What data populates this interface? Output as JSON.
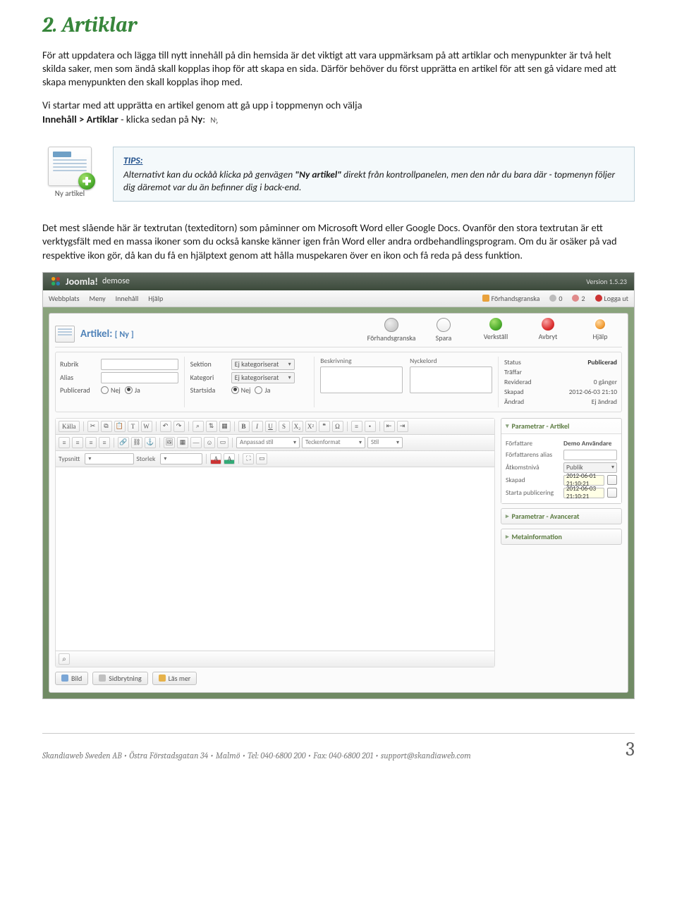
{
  "section_title": "2. Artiklar",
  "para1": "För att uppdatera och lägga till nytt innehåll på din hemsida är det viktigt att vara uppmärksam på att artiklar och menypunkter är två helt skilda saker, men som ändå skall kopplas ihop för att skapa en sida. Därför behöver du först upprätta en artikel för att sen gå vidare med att skapa menypunkten den skall kopplas ihop med.",
  "para2_a": "Vi startar med att upprätta en artikel genom att gå upp i  toppmenyn och välja",
  "para2_b_bold": "Innehåll > Artiklar",
  "para2_c": " - klicka sedan på N",
  "para2_d_bold": "y",
  "para2_e": ":",
  "ny_label": "Ny",
  "thumb_label": "Ny artikel",
  "tips_head": "TIPS:",
  "tips_body_a": "Alternativt kan du ockåå klicka på genvägen ",
  "tips_body_b": "\"Ny artikel\"",
  "tips_body_c": " direkt från kontrollpanelen, men den når du bara där  - topmenyn följer dig däremot var du än befinner dig i back-end.",
  "para3": "Det mest slående här är textrutan (texteditorn) som påminner om Microsoft Word eller Google Docs. Ovanför den stora textrutan är ett verktygsfält med en massa ikoner som du också kanske känner igen från Word eller andra ordbehandlingsprogram. Om du är osäker på vad respektive ikon gör, då kan du få en hjälptext genom att hålla muspekaren över en ikon och få reda på dess funktion.",
  "joomla": {
    "logo": "Joomla!",
    "site": "demose",
    "version": "Version 1.5.23",
    "menubar": {
      "items": [
        "Webbplats",
        "Meny",
        "Innehåll",
        "Hjälp"
      ],
      "right": {
        "preview": "Förhandsgranska",
        "msg": "0",
        "users": "2",
        "logout": "Logga ut"
      }
    },
    "title": "Artikel:",
    "title_sub": "[ Ny ]",
    "toolbar": [
      "Förhandsgranska",
      "Spara",
      "Verkställ",
      "Avbryt",
      "Hjälp"
    ],
    "form_left": {
      "rubrik": "Rubrik",
      "alias": "Alias",
      "publicerad": "Publicerad",
      "nej": "Nej",
      "ja": "Ja"
    },
    "form_left2": {
      "sektion": "Sektion",
      "kategori": "Kategori",
      "startsida": "Startsida",
      "sektion_val": "Ej kategoriserat",
      "kategori_val": "Ej kategoriserat"
    },
    "form_mid": {
      "beskrivning": "Beskrivning",
      "nyckelord": "Nyckelord"
    },
    "form_right": {
      "status_l": "Status",
      "status_v": "Publicerad",
      "traffar": "Träffar",
      "rev_l": "Reviderad",
      "rev_v": "0 gånger",
      "skapad_l": "Skapad",
      "skapad_v": "2012-06-03 21:10",
      "andrad_l": "Ändrad",
      "andrad_v": "Ej ändrad"
    },
    "editor": {
      "kalla": "Källa",
      "row2": {
        "typsnitt": "Typsnitt",
        "storlek": "Storlek",
        "anpassad": "Anpassad stil",
        "tecken": "Teckenformat",
        "stil": "Stil"
      },
      "footer_btns": [
        "Bild",
        "Sidbrytning",
        "Läs mer"
      ]
    },
    "sidebar": {
      "p_artikel": "Parametrar - Artikel",
      "forfattare_l": "Författare",
      "forfattare_v": "Demo Användare",
      "forfalias": "Författarens alias",
      "atkomst_l": "Åtkomstnivå",
      "atkomst_v": "Publik",
      "skapad_l": "Skapad",
      "skapad_v": "2012-06-01 21:10:21",
      "start_l": "Starta publicering",
      "start_v": "2012-06-03 21:10:21",
      "p_avancerat": "Parametrar - Avancerat",
      "metainfo": "Metainformation"
    }
  },
  "footer_text": "Skandiaweb Sweden AB • Östra Förstadsgatan 34 • Malmö • Tel: 040-6800 200 • Fax: 040-6800 201 • support@skandiaweb.com",
  "page_number": "3"
}
